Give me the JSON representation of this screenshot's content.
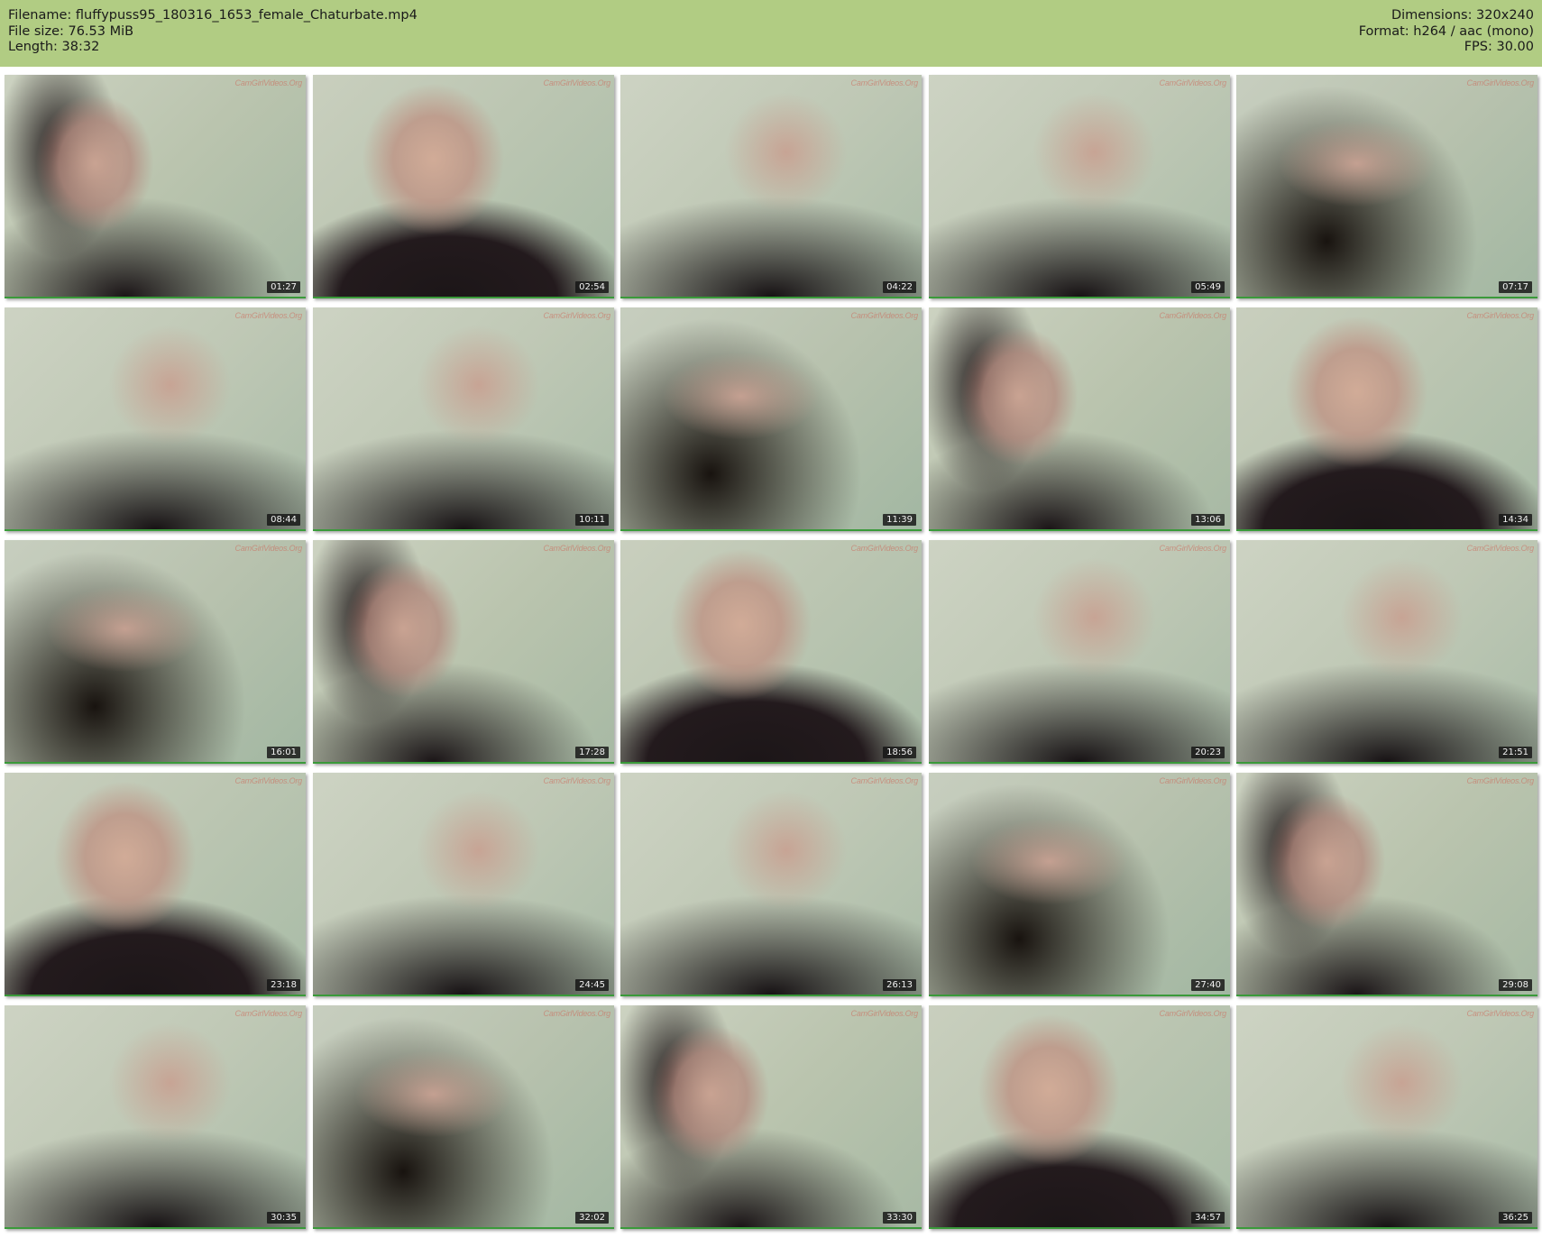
{
  "header": {
    "filename": "Filename: fluffypuss95_180316_1653_female_Chaturbate.mp4",
    "file_size": "File size: 76.53 MiB",
    "length": "Length: 38:32",
    "dimensions": "Dimensions: 320x240",
    "format": "Format: h264 / aac (mono)",
    "fps": "FPS: 30.00"
  },
  "watermark": "CamGirlVideos.Org",
  "colors": {
    "header_bg": "#b1cc83",
    "thumb_border": "#3a9a3a"
  },
  "thumbnails": [
    {
      "time": "01:27"
    },
    {
      "time": "02:54"
    },
    {
      "time": "04:22"
    },
    {
      "time": "05:49"
    },
    {
      "time": "07:17"
    },
    {
      "time": "08:44"
    },
    {
      "time": "10:11"
    },
    {
      "time": "11:39"
    },
    {
      "time": "13:06"
    },
    {
      "time": "14:34"
    },
    {
      "time": "16:01"
    },
    {
      "time": "17:28"
    },
    {
      "time": "18:56"
    },
    {
      "time": "20:23"
    },
    {
      "time": "21:51"
    },
    {
      "time": "23:18"
    },
    {
      "time": "24:45"
    },
    {
      "time": "26:13"
    },
    {
      "time": "27:40"
    },
    {
      "time": "29:08"
    },
    {
      "time": "30:35"
    },
    {
      "time": "32:02"
    },
    {
      "time": "33:30"
    },
    {
      "time": "34:57"
    },
    {
      "time": "36:25"
    }
  ]
}
